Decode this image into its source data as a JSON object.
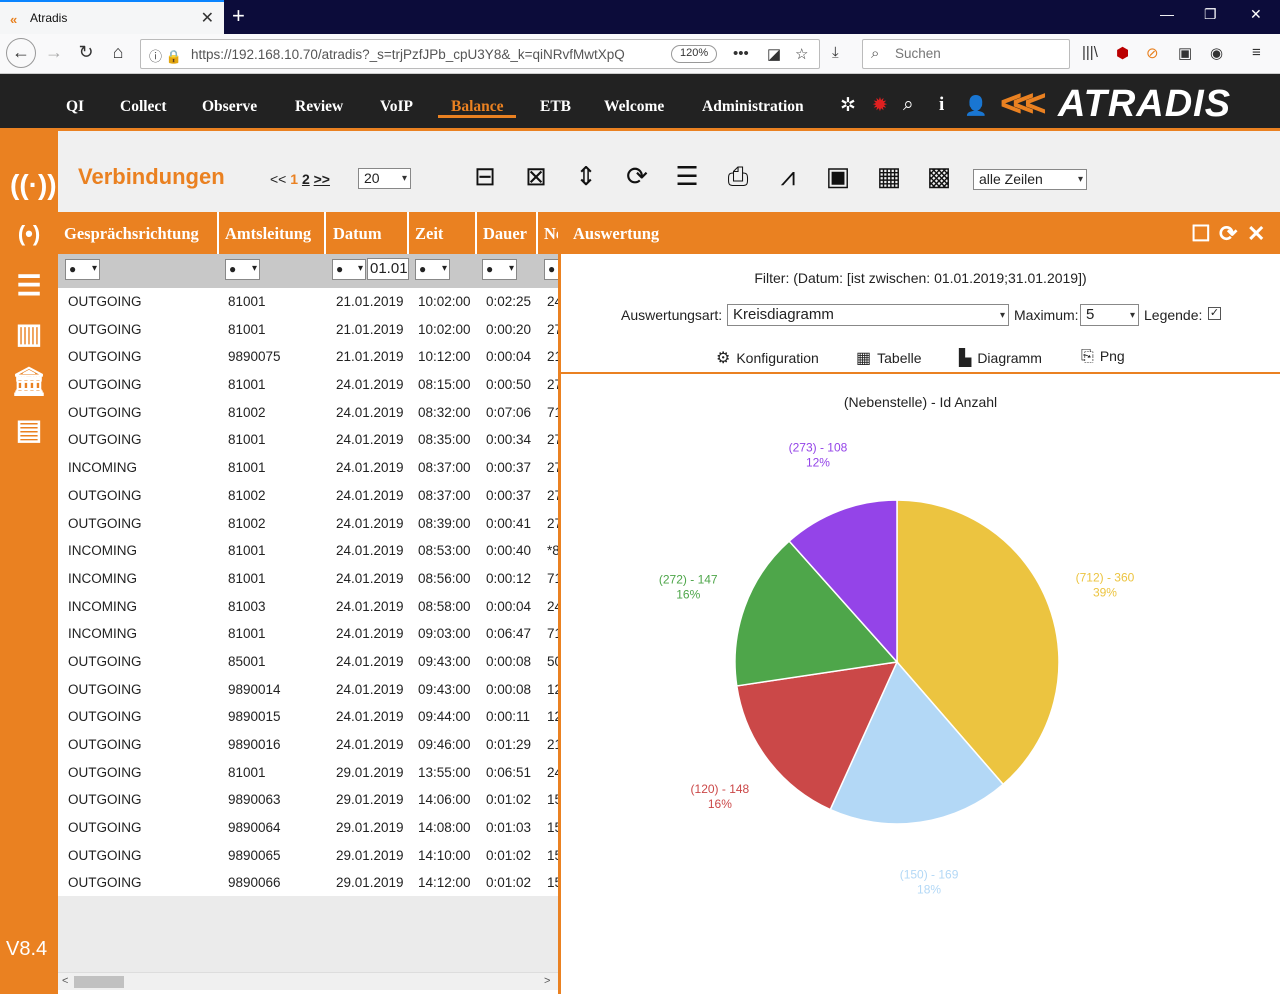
{
  "browser": {
    "tab_title": "Atradis",
    "url": "https://192.168.10.70/atradis?_s=trjPzfJPb_cpU3Y8&_k=qiNRvfMwtXpQ",
    "zoom": "120%",
    "search_placeholder": "Suchen"
  },
  "menu": {
    "items": [
      "QI",
      "Collect",
      "Observe",
      "Review",
      "VoIP",
      "Balance",
      "ETB",
      "Welcome",
      "Administration"
    ],
    "active": "Balance",
    "logo_text": "ATRADIS"
  },
  "sidebar": {
    "version": "V8.4",
    "icons": [
      "antenna-icon",
      "broadcast-icon",
      "coins-icon",
      "columns-icon",
      "bank-icon",
      "document-icon"
    ]
  },
  "toolbar": {
    "title": "Verbindungen",
    "pager_prev": "<<",
    "pager_page1": "1",
    "pager_page2": "2",
    "pager_next": ">>",
    "page_size": "20",
    "rows_select": "alle Zeilen"
  },
  "table": {
    "headers": [
      "Gesprächsrichtung",
      "Amtsleitung",
      "Datum",
      "Zeit",
      "Dauer",
      "Ne"
    ],
    "filter_bullet": "●",
    "filter_datum_input": "01.01",
    "rows": [
      [
        "OUTGOING",
        "81001",
        "21.01.2019",
        "10:02:00",
        "0:02:25",
        "24"
      ],
      [
        "OUTGOING",
        "81001",
        "21.01.2019",
        "10:02:00",
        "0:00:20",
        "27"
      ],
      [
        "OUTGOING",
        "9890075",
        "21.01.2019",
        "10:12:00",
        "0:00:04",
        "21"
      ],
      [
        "OUTGOING",
        "81001",
        "24.01.2019",
        "08:15:00",
        "0:00:50",
        "27"
      ],
      [
        "OUTGOING",
        "81002",
        "24.01.2019",
        "08:32:00",
        "0:07:06",
        "71"
      ],
      [
        "OUTGOING",
        "81001",
        "24.01.2019",
        "08:35:00",
        "0:00:34",
        "27"
      ],
      [
        "INCOMING",
        "81001",
        "24.01.2019",
        "08:37:00",
        "0:00:37",
        "27"
      ],
      [
        "OUTGOING",
        "81002",
        "24.01.2019",
        "08:37:00",
        "0:00:37",
        "27"
      ],
      [
        "OUTGOING",
        "81002",
        "24.01.2019",
        "08:39:00",
        "0:00:41",
        "27"
      ],
      [
        "INCOMING",
        "81001",
        "24.01.2019",
        "08:53:00",
        "0:00:40",
        "*8"
      ],
      [
        "INCOMING",
        "81001",
        "24.01.2019",
        "08:56:00",
        "0:00:12",
        "71"
      ],
      [
        "INCOMING",
        "81003",
        "24.01.2019",
        "08:58:00",
        "0:00:04",
        "24"
      ],
      [
        "INCOMING",
        "81001",
        "24.01.2019",
        "09:03:00",
        "0:06:47",
        "71"
      ],
      [
        "OUTGOING",
        "85001",
        "24.01.2019",
        "09:43:00",
        "0:00:08",
        "50"
      ],
      [
        "OUTGOING",
        "9890014",
        "24.01.2019",
        "09:43:00",
        "0:00:08",
        "12"
      ],
      [
        "OUTGOING",
        "9890015",
        "24.01.2019",
        "09:44:00",
        "0:00:11",
        "12"
      ],
      [
        "OUTGOING",
        "9890016",
        "24.01.2019",
        "09:46:00",
        "0:01:29",
        "21"
      ],
      [
        "OUTGOING",
        "81001",
        "29.01.2019",
        "13:55:00",
        "0:06:51",
        "24"
      ],
      [
        "OUTGOING",
        "9890063",
        "29.01.2019",
        "14:06:00",
        "0:01:02",
        "15"
      ],
      [
        "OUTGOING",
        "9890064",
        "29.01.2019",
        "14:08:00",
        "0:01:03",
        "15"
      ],
      [
        "OUTGOING",
        "9890065",
        "29.01.2019",
        "14:10:00",
        "0:01:02",
        "15"
      ],
      [
        "OUTGOING",
        "9890066",
        "29.01.2019",
        "14:12:00",
        "0:01:02",
        "15"
      ]
    ]
  },
  "auswertung": {
    "title": "Auswertung",
    "filter_text": "Filter: (Datum: [ist zwischen: 01.01.2019;31.01.2019])",
    "art_label": "Auswertungsart:",
    "art_value": "Kreisdiagramm",
    "max_label": "Maximum:",
    "max_value": "5",
    "legend_label": "Legende:",
    "legend_checked": "✓",
    "buttons": [
      "Konfiguration",
      "Tabelle",
      "Diagramm",
      "Png"
    ]
  },
  "chart_data": {
    "type": "pie",
    "title": "(Nebenstelle) - Id Anzahl",
    "slices": [
      {
        "label": "(712) - 360",
        "percent": "39%",
        "value": 360,
        "color": "#ecc440"
      },
      {
        "label": "(150) - 169",
        "percent": "18%",
        "value": 169,
        "color": "#b3d8f6"
      },
      {
        "label": "(120) - 148",
        "percent": "16%",
        "value": 148,
        "color": "#cb4848"
      },
      {
        "label": "(272) - 147",
        "percent": "16%",
        "value": 147,
        "color": "#4ea64a"
      },
      {
        "label": "(273) - 108",
        "percent": "12%",
        "value": 108,
        "color": "#9444e8"
      }
    ]
  }
}
